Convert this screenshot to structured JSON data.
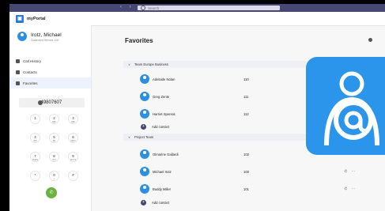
{
  "window": {
    "nav_back": "‹",
    "nav_forward": "›",
    "search_placeholder": "Search"
  },
  "app": {
    "title": "myPortal",
    "logo": "▣"
  },
  "profile": {
    "name": "Irotz, Michael",
    "status": "Controlled Service 100"
  },
  "menu": [
    {
      "label": "Call History",
      "icon": "history-icon"
    },
    {
      "label": "Contacts",
      "icon": "contacts-icon"
    },
    {
      "label": "Favorites",
      "icon": "favorites-icon"
    }
  ],
  "dialer": {
    "number": "+49807607",
    "keys": [
      {
        "digit": "1",
        "sub": ""
      },
      {
        "digit": "2",
        "sub": "ABC"
      },
      {
        "digit": "3",
        "sub": "DEF"
      },
      {
        "digit": "4",
        "sub": "GHI"
      },
      {
        "digit": "5",
        "sub": "JKL"
      },
      {
        "digit": "6",
        "sub": "MNO"
      },
      {
        "digit": "7",
        "sub": "PQRS"
      },
      {
        "digit": "8",
        "sub": "TUV"
      },
      {
        "digit": "9",
        "sub": "WXYZ"
      },
      {
        "digit": "*",
        "sub": ""
      },
      {
        "digit": "0",
        "sub": "+"
      },
      {
        "digit": "#",
        "sub": ""
      }
    ],
    "call_icon": "phone-icon"
  },
  "favorites": {
    "title": "Favorites",
    "groups": [
      {
        "name": "Team Europe Business",
        "contacts": [
          {
            "name": "Adelaide Nolan",
            "ext": "110"
          },
          {
            "name": "Greg Zente",
            "ext": "111"
          },
          {
            "name": "Harriet Spensis",
            "ext": "112"
          }
        ],
        "add_label": "Add contact"
      },
      {
        "name": "Project Team",
        "contacts": [
          {
            "name": "Olmarine Gallardi",
            "ext": "102",
            "actions": ""
          },
          {
            "name": "Michael Irotz",
            "ext": "100",
            "actions": "✆ ⋯"
          },
          {
            "name": "Buddy Miller",
            "ext": "101",
            "actions": "✆ ⋯"
          }
        ],
        "add_label": "Add contact"
      }
    ]
  },
  "colors": {
    "titlebar": "#464775",
    "accent": "#2a95eb",
    "call": "#6cb33e"
  },
  "badge_icon": "contact-at-icon"
}
